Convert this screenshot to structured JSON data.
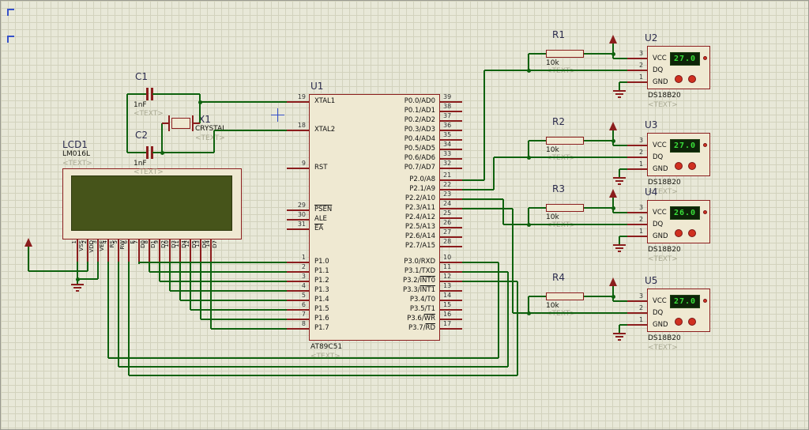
{
  "colors": {
    "wire": "#0e620e",
    "component_border": "#8b1d1d",
    "component_fill": "#efe9d2",
    "sheet_bg": "#e8e8d8",
    "grid": "#d2d2bd",
    "display_bg": "#0d2408",
    "display_text": "#3ae03a",
    "lcd_screen": "#46541a",
    "marker_blue": "#3550c8"
  },
  "u1": {
    "ref": "U1",
    "value": "AT89C51",
    "text": "<TEXT>",
    "left_pins": [
      {
        "num": "19",
        "name": "XTAL1"
      },
      {
        "num": "18",
        "name": "XTAL2"
      },
      {
        "num": "9",
        "name": "RST"
      },
      {
        "num": "29",
        "name": "PSEN",
        "overline": true
      },
      {
        "num": "30",
        "name": "ALE"
      },
      {
        "num": "31",
        "name": "EA",
        "overline": true
      },
      {
        "num": "1",
        "name": "P1.0"
      },
      {
        "num": "2",
        "name": "P1.1"
      },
      {
        "num": "3",
        "name": "P1.2"
      },
      {
        "num": "4",
        "name": "P1.3"
      },
      {
        "num": "5",
        "name": "P1.4"
      },
      {
        "num": "6",
        "name": "P1.5"
      },
      {
        "num": "7",
        "name": "P1.6"
      },
      {
        "num": "8",
        "name": "P1.7"
      }
    ],
    "right_pins": [
      {
        "num": "39",
        "name": "P0.0/AD0"
      },
      {
        "num": "38",
        "name": "P0.1/AD1"
      },
      {
        "num": "37",
        "name": "P0.2/AD2"
      },
      {
        "num": "36",
        "name": "P0.3/AD3"
      },
      {
        "num": "35",
        "name": "P0.4/AD4"
      },
      {
        "num": "34",
        "name": "P0.5/AD5"
      },
      {
        "num": "33",
        "name": "P0.6/AD6"
      },
      {
        "num": "32",
        "name": "P0.7/AD7"
      },
      {
        "num": "21",
        "name": "P2.0/A8"
      },
      {
        "num": "22",
        "name": "P2.1/A9"
      },
      {
        "num": "23",
        "name": "P2.2/A10"
      },
      {
        "num": "24",
        "name": "P2.3/A11"
      },
      {
        "num": "25",
        "name": "P2.4/A12"
      },
      {
        "num": "26",
        "name": "P2.5/A13"
      },
      {
        "num": "27",
        "name": "P2.6/A14"
      },
      {
        "num": "28",
        "name": "P2.7/A15"
      },
      {
        "num": "10",
        "name": "P3.0/RXD"
      },
      {
        "num": "11",
        "name": "P3.1/TXD"
      },
      {
        "num": "12",
        "name": "P3.2/INT0",
        "overline": "INT0"
      },
      {
        "num": "13",
        "name": "P3.3/INT1",
        "overline": "INT1"
      },
      {
        "num": "14",
        "name": "P3.4/T0"
      },
      {
        "num": "15",
        "name": "P3.5/T1"
      },
      {
        "num": "16",
        "name": "P3.6/WR",
        "overline": "WR"
      },
      {
        "num": "17",
        "name": "P3.7/RD",
        "overline": "RD"
      }
    ]
  },
  "lcd": {
    "ref": "LCD1",
    "model": "LM016L",
    "text": "<TEXT>",
    "pins": [
      {
        "num": "1",
        "name": "VSS"
      },
      {
        "num": "2",
        "name": "VDD"
      },
      {
        "num": "3",
        "name": "VEE"
      },
      {
        "num": "4",
        "name": "RS"
      },
      {
        "num": "5",
        "name": "RW"
      },
      {
        "num": "6",
        "name": "E"
      },
      {
        "num": "7",
        "name": "D0"
      },
      {
        "num": "8",
        "name": "D1"
      },
      {
        "num": "9",
        "name": "D2"
      },
      {
        "num": "10",
        "name": "D3"
      },
      {
        "num": "11",
        "name": "D4"
      },
      {
        "num": "12",
        "name": "D5"
      },
      {
        "num": "13",
        "name": "D6"
      },
      {
        "num": "14",
        "name": "D7"
      }
    ]
  },
  "capacitors": [
    {
      "ref": "C1",
      "value": "1nF",
      "text": "<TEXT>"
    },
    {
      "ref": "C2",
      "value": "1nF",
      "text": "<TEXT>"
    }
  ],
  "crystal": {
    "ref": "X1",
    "value": "CRYSTAL",
    "text": "<TEXT>"
  },
  "resistors": [
    {
      "ref": "R1",
      "value": "10k",
      "text": "<TEXT>"
    },
    {
      "ref": "R2",
      "value": "10k",
      "text": "<TEXT>"
    },
    {
      "ref": "R3",
      "value": "10k",
      "text": "<TEXT>"
    },
    {
      "ref": "R4",
      "value": "10k",
      "text": "<TEXT>"
    }
  ],
  "sensors": [
    {
      "ref": "U2",
      "model": "DS18B20",
      "text": "<TEXT>",
      "reading": "27.0",
      "pins": [
        {
          "num": "3",
          "name": "VCC"
        },
        {
          "num": "2",
          "name": "DQ"
        },
        {
          "num": "1",
          "name": "GND"
        }
      ]
    },
    {
      "ref": "U3",
      "model": "DS18B20",
      "text": "<TEXT>",
      "reading": "27.0",
      "pins": [
        {
          "num": "3",
          "name": "VCC"
        },
        {
          "num": "2",
          "name": "DQ"
        },
        {
          "num": "1",
          "name": "GND"
        }
      ]
    },
    {
      "ref": "U4",
      "model": "DS18B20",
      "text": "<TEXT>",
      "reading": "26.0",
      "pins": [
        {
          "num": "3",
          "name": "VCC"
        },
        {
          "num": "2",
          "name": "DQ"
        },
        {
          "num": "1",
          "name": "GND"
        }
      ]
    },
    {
      "ref": "U5",
      "model": "DS18B20",
      "text": "<TEXT>",
      "reading": "27.0",
      "pins": [
        {
          "num": "3",
          "name": "VCC"
        },
        {
          "num": "2",
          "name": "DQ"
        },
        {
          "num": "1",
          "name": "GND"
        }
      ]
    }
  ]
}
